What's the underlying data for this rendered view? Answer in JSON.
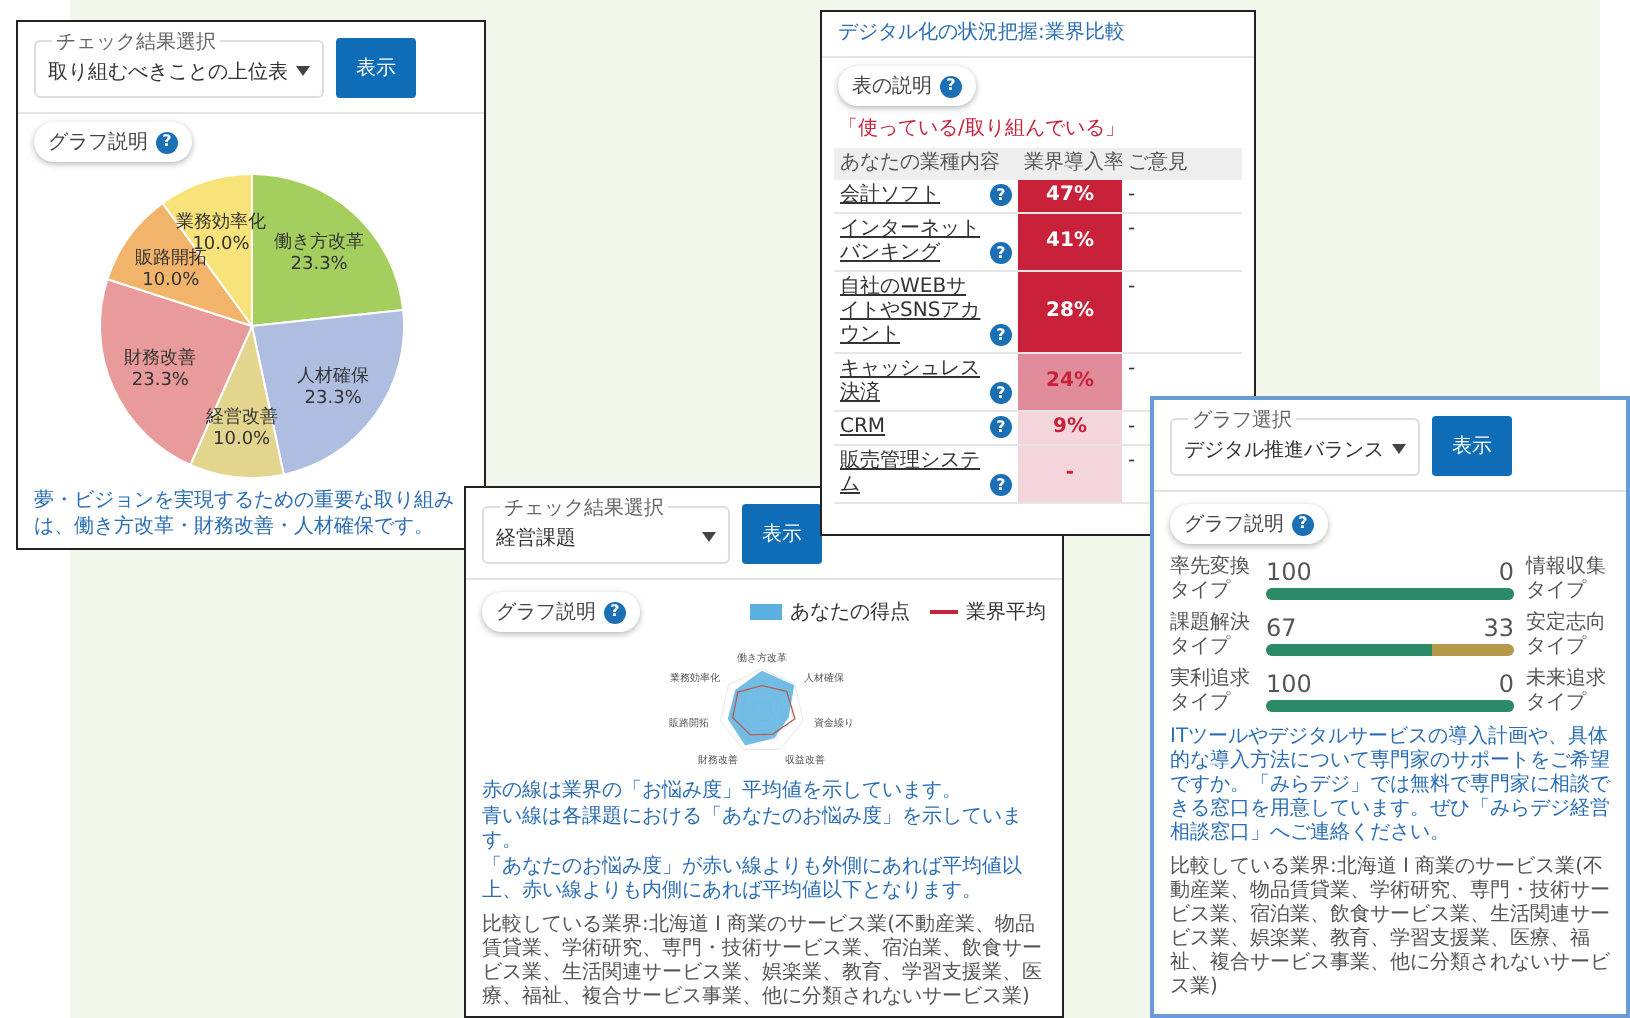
{
  "pie_panel": {
    "select": {
      "label": "チェック結果選択",
      "value": "取り組むべきことの上位表"
    },
    "button": "表示",
    "help": {
      "label": "グラフ説明",
      "icon": "?"
    },
    "chart_data": {
      "type": "pie",
      "categories": [
        "働き方改革",
        "人材確保",
        "経営改善",
        "財務改善",
        "販路開拓",
        "業務効率化"
      ],
      "values": [
        23.3,
        23.3,
        10.0,
        23.3,
        10.0,
        10.0
      ],
      "data_labels": true,
      "value_labels": [
        "23.3%",
        "23.3%",
        "10.0%",
        "23.3%",
        "10.0%",
        "10.0%"
      ]
    },
    "footer": "夢・ビジョンを実現するための重要な取り組みは、働き方改革・財務改善・人材確保です。"
  },
  "table_panel": {
    "title": "デジタル化の状況把握:業界比較",
    "help": {
      "label": "表の説明",
      "icon": "?"
    },
    "heading": "「使っている/取り組んでいる」",
    "columns": [
      "あなたの業種内容",
      "業界導入率",
      "ご意見"
    ],
    "rows": [
      {
        "name": "会計ソフト",
        "info": "?",
        "rate": "47%",
        "color": "#c9213a",
        "opinion": "-"
      },
      {
        "name": "インターネットバンキング",
        "info": "?",
        "rate": "41%",
        "color": "#c9213a",
        "opinion": "-"
      },
      {
        "name": "自社のWEBサイトやSNSアカウント",
        "info": "?",
        "rate": "28%",
        "color": "#c9213a",
        "opinion": "-"
      },
      {
        "name": "キャッシュレス決済",
        "info": "?",
        "rate": "24%",
        "color": "#e08c9b",
        "opinion": "-"
      },
      {
        "name": "CRM",
        "info": "?",
        "rate": "9%",
        "color": "#f5d5dc",
        "opinion": "-"
      },
      {
        "name": "販売管理システム",
        "info": "?",
        "rate": "-",
        "color": "#f5d5dc",
        "opinion": "-"
      }
    ]
  },
  "radar_panel": {
    "select": {
      "label": "チェック結果選択",
      "value": "経営課題"
    },
    "button": "表示",
    "help": {
      "label": "グラフ説明",
      "icon": "?"
    },
    "legend": [
      {
        "kind": "area",
        "label": "あなたの得点"
      },
      {
        "kind": "line",
        "label": "業界平均"
      }
    ],
    "axes": [
      "働き方改革",
      "人材確保",
      "資金繰り",
      "収益改善",
      "財務改善",
      "販路開拓",
      "業務効率化"
    ],
    "notes": [
      "赤の線は業界の「お悩み度」平均値を示しています。",
      "青い線は各課題における「あなたのお悩み度」を示しています。",
      "「あなたのお悩み度」が赤い線よりも外側にあれば平均値以上、赤い線よりも内側にあれば平均値以下となります。"
    ],
    "industry": "比較している業界:北海道 Ⅰ 商業のサービス業(不動産業、物品賃貸業、学術研究、専門・技術サービス業、宿泊業、飲食サービス業、生活関連サービス業、娯楽業、教育、学習支援業、医療、福祉、複合サービス事業、他に分類されないサービス業)"
  },
  "balance_panel": {
    "select": {
      "label": "グラフ選択",
      "value": "デジタル推進バランス"
    },
    "button": "表示",
    "help": {
      "label": "グラフ説明",
      "icon": "?"
    },
    "bars": [
      {
        "left": "率先変換タイプ",
        "right": "情報収集タイプ",
        "left_value": "100",
        "right_value": "0",
        "level": 1.0
      },
      {
        "left": "課題解決タイプ",
        "right": "安定志向タイプ",
        "left_value": "67",
        "right_value": "33",
        "level": 0.67
      },
      {
        "left": "実利追求タイプ",
        "right": "未来追求タイプ",
        "left_value": "100",
        "right_value": "0",
        "level": 1.0
      }
    ],
    "note": "ITツールやデジタルサービスの導入計画や、具体的な導入方法について専門家のサポートをご希望ですか。「みらデジ」では無料で専門家に相談できる窓口を用意しています。ぜひ「みらデジ経営相談窓口」へご連絡ください。",
    "industry": "比較している業界:北海道 Ⅰ 商業のサービス業(不動産業、物品賃貸業、学術研究、専門・技術サービス業、宿泊業、飲食サービス業、生活関連サービス業、娯楽業、教育、学習支援業、医療、福祉、複合サービス事業、他に分類されないサービス業)"
  }
}
